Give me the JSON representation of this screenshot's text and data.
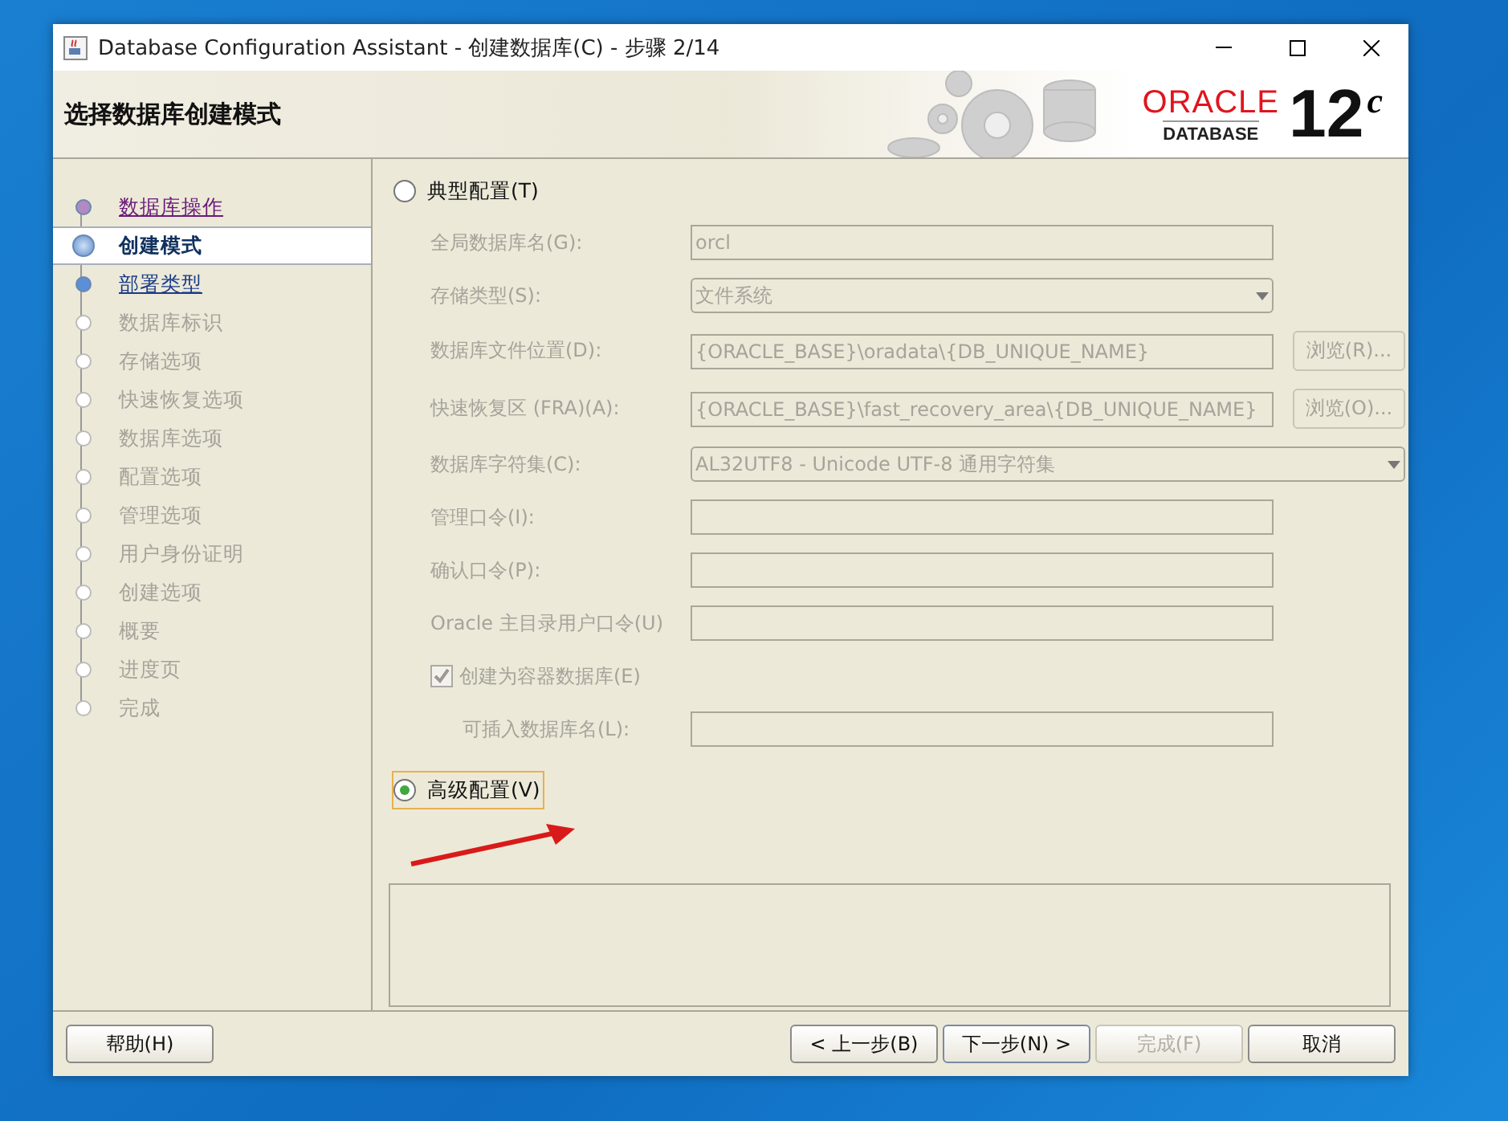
{
  "window": {
    "title": "Database Configuration Assistant - 创建数据库(C) - 步骤 2/14"
  },
  "header": {
    "title": "选择数据库创建模式",
    "logo": {
      "brand": "ORACLE",
      "product": "DATABASE",
      "version": "12",
      "version_suffix": "c"
    }
  },
  "steps": [
    {
      "label": "数据库操作",
      "kind": "visited",
      "selected": false
    },
    {
      "label": "创建模式",
      "kind": "current",
      "selected": true
    },
    {
      "label": "部署类型",
      "kind": "next",
      "selected": false
    },
    {
      "label": "数据库标识",
      "kind": "pending",
      "selected": false
    },
    {
      "label": "存储选项",
      "kind": "pending",
      "selected": false
    },
    {
      "label": "快速恢复选项",
      "kind": "pending",
      "selected": false
    },
    {
      "label": "数据库选项",
      "kind": "pending",
      "selected": false
    },
    {
      "label": "配置选项",
      "kind": "pending",
      "selected": false
    },
    {
      "label": "管理选项",
      "kind": "pending",
      "selected": false
    },
    {
      "label": "用户身份证明",
      "kind": "pending",
      "selected": false
    },
    {
      "label": "创建选项",
      "kind": "pending",
      "selected": false
    },
    {
      "label": "概要",
      "kind": "pending",
      "selected": false
    },
    {
      "label": "进度页",
      "kind": "pending",
      "selected": false
    },
    {
      "label": "完成",
      "kind": "pending",
      "selected": false
    }
  ],
  "typical": {
    "label": "典型配置(T)",
    "selected": false
  },
  "fields": [
    {
      "label": "全局数据库名(G):",
      "value": "orcl",
      "kind": "text",
      "disabled": true
    },
    {
      "label": "存储类型(S):",
      "value": "文件系统",
      "kind": "select",
      "disabled": true
    },
    {
      "label": "数据库文件位置(D):",
      "value": "{ORACLE_BASE}\\oradata\\{DB_UNIQUE_NAME}",
      "kind": "text",
      "browse": "浏览(R)...",
      "disabled": true
    },
    {
      "label": "快速恢复区 (FRA)(A):",
      "value": "{ORACLE_BASE}\\fast_recovery_area\\{DB_UNIQUE_NAME}",
      "kind": "text",
      "browse": "浏览(O)...",
      "disabled": true
    },
    {
      "label": "数据库字符集(C):",
      "value": "AL32UTF8 - Unicode UTF-8 通用字符集",
      "kind": "wideselect",
      "disabled": true
    },
    {
      "label": "管理口令(I):",
      "kind": "text",
      "disabled": true
    },
    {
      "label": "确认口令(P):",
      "kind": "text",
      "disabled": true
    },
    {
      "label": "Oracle 主目录用户口令(U)",
      "kind": "text",
      "disabled": true
    }
  ],
  "container": {
    "label": "创建为容器数据库(E)",
    "checked": true,
    "disabled": true
  },
  "pluggable": {
    "label": "可插入数据库名(L):",
    "disabled": true
  },
  "advanced": {
    "label": "高级配置(V)",
    "selected": true
  },
  "buttons": [
    {
      "label": "帮助(H)",
      "kind": "help",
      "disabled": false
    },
    {
      "label": "< 上一步(B)",
      "kind": "nav",
      "disabled": false
    },
    {
      "label": "下一步(N) >",
      "kind": "default",
      "disabled": false
    },
    {
      "label": "完成(F)",
      "kind": "nav",
      "disabled": true
    },
    {
      "label": "取消",
      "kind": "nav",
      "disabled": false
    }
  ]
}
